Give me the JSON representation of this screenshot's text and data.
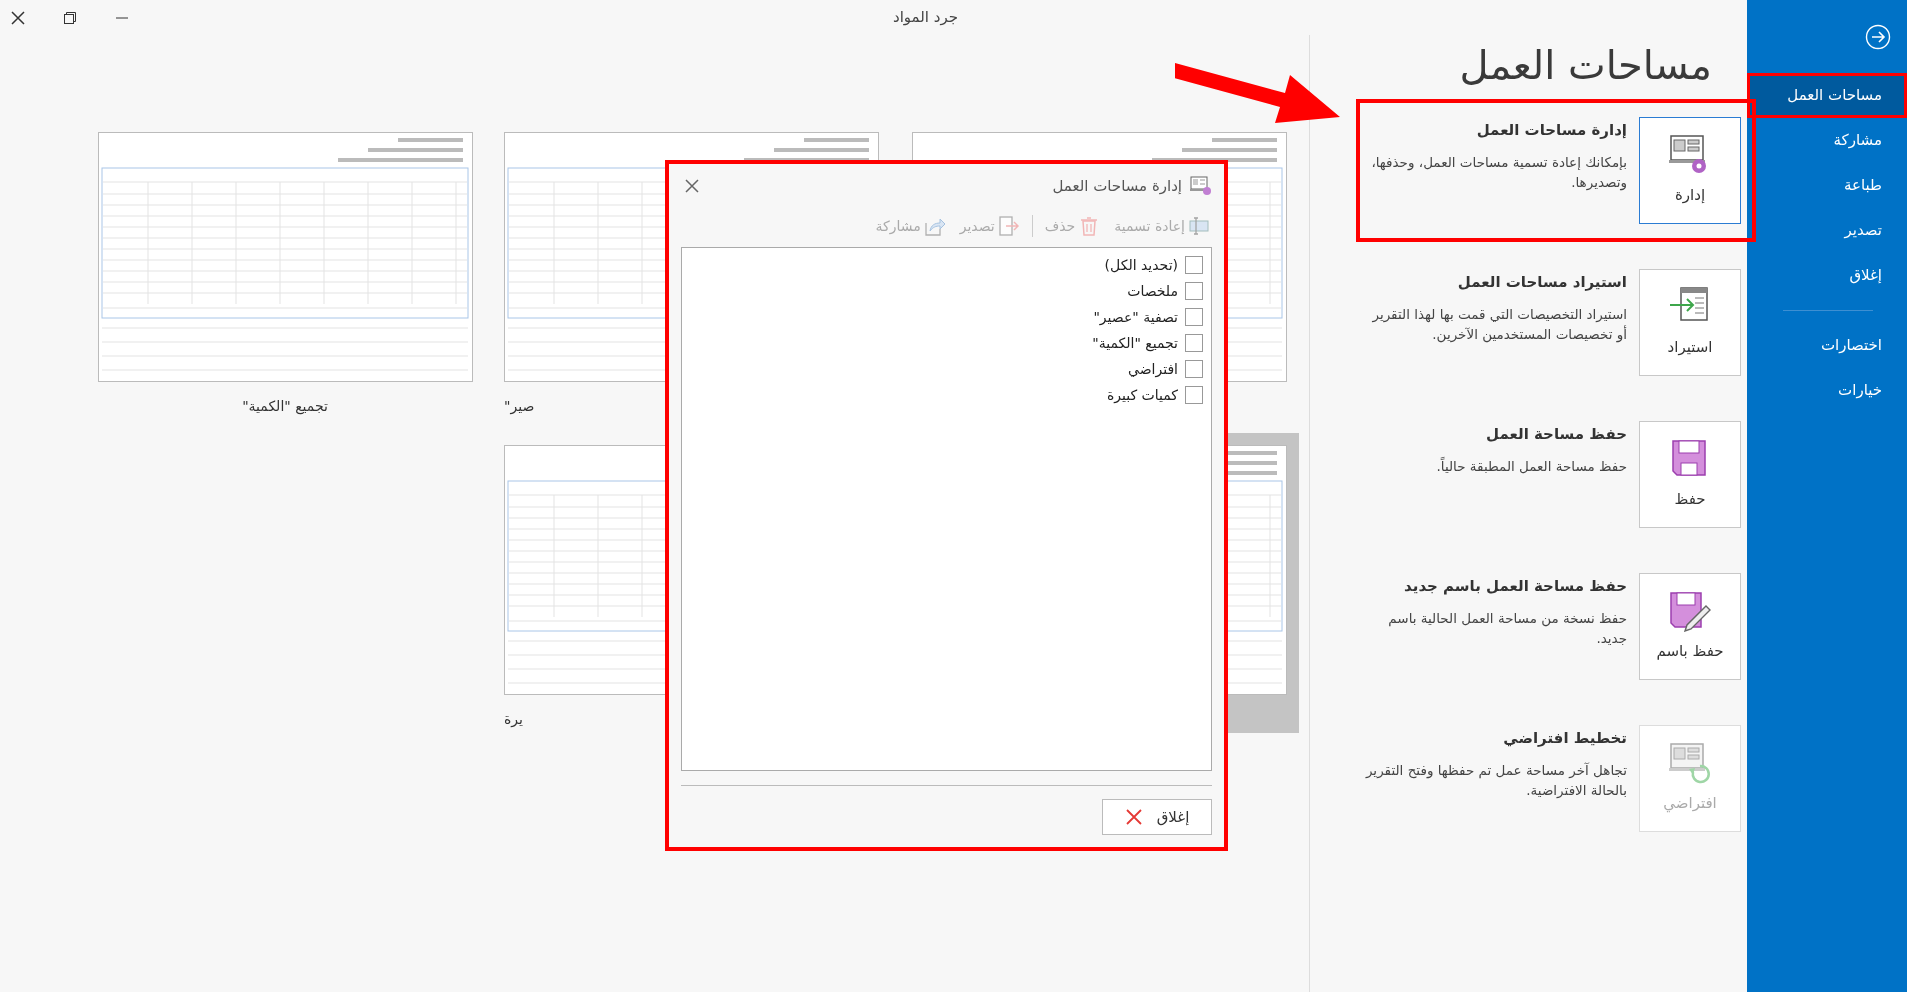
{
  "window": {
    "title": "جرد المواد"
  },
  "sidebar": {
    "items": [
      {
        "label": "مساحات العمل",
        "selected": true,
        "highlighted": true
      },
      {
        "label": "مشاركة",
        "selected": false,
        "highlighted": false
      },
      {
        "label": "طباعة",
        "selected": false,
        "highlighted": false
      },
      {
        "label": "تصدير",
        "selected": false,
        "highlighted": false
      },
      {
        "label": "إغلاق",
        "selected": false,
        "highlighted": false
      }
    ],
    "more_items": [
      {
        "label": "اختصارات",
        "selected": false
      },
      {
        "label": "خيارات",
        "selected": false
      }
    ]
  },
  "workspaces": {
    "heading": "مساحات العمل",
    "actions": [
      {
        "kind": "manage",
        "title": "إدارة مساحات العمل",
        "description": "بإمكانك إعادة تسمية مساحات العمل، وحذفها، وتصديرها.",
        "button": "إدارة",
        "disabled": false,
        "highlighted": true
      },
      {
        "kind": "import",
        "title": "استيراد مساحات العمل",
        "description": "استيراد التخصيصات التي قمت بها لهذا التقرير أو تخصيصات المستخدمين الآخرين.",
        "button": "استيراد",
        "disabled": false,
        "highlighted": false
      },
      {
        "kind": "save",
        "title": "حفظ مساحة العمل",
        "description": "حفظ مساحة العمل المطبقة حالياً.",
        "button": "حفظ",
        "disabled": false,
        "highlighted": false
      },
      {
        "kind": "save_as",
        "title": "حفظ مساحة العمل باسم جديد",
        "description": "حفظ نسخة من مساحة العمل الحالية باسم جديد.",
        "button": "حفظ باسم",
        "disabled": false,
        "highlighted": false
      },
      {
        "kind": "reset",
        "title": "تخطيط افتراضي",
        "description": "تجاهل آخر مساحة عمل تم حفظها وفتح التقرير بالحالة الافتراضية.",
        "button": "افتراضي",
        "disabled": true,
        "highlighted": false
      }
    ]
  },
  "gallery": {
    "thumbnails": [
      {
        "selected": false
      },
      {
        "caption": "صير\"",
        "selected": false
      },
      {
        "caption": "تجميع \"الكمية\"",
        "selected": false
      },
      {
        "selected": true
      },
      {
        "caption": "يرة",
        "selected": false
      }
    ]
  },
  "dialog": {
    "title": "إدارة مساحات العمل",
    "highlighted": true,
    "toolbar_groups": [
      {
        "items": [
          {
            "kind": "rename",
            "label": "إعادة تسمية",
            "disabled": true
          },
          {
            "kind": "delete",
            "label": "حذف",
            "disabled": true
          }
        ]
      },
      {
        "items": [
          {
            "kind": "export",
            "label": "تصدير",
            "disabled": true
          },
          {
            "kind": "share",
            "label": "مشاركة",
            "disabled": true
          }
        ]
      }
    ],
    "items": [
      {
        "label": "(تحديد الكل)",
        "checked": false
      },
      {
        "label": "ملخصات",
        "checked": false
      },
      {
        "label": "تصفية \"عصير\"",
        "checked": false
      },
      {
        "label": "تجميع \"الكمية\"",
        "checked": false
      },
      {
        "label": "افتراضي",
        "checked": false
      },
      {
        "label": "كميات كبيرة",
        "checked": false
      }
    ],
    "close_button": "إغلاق"
  }
}
